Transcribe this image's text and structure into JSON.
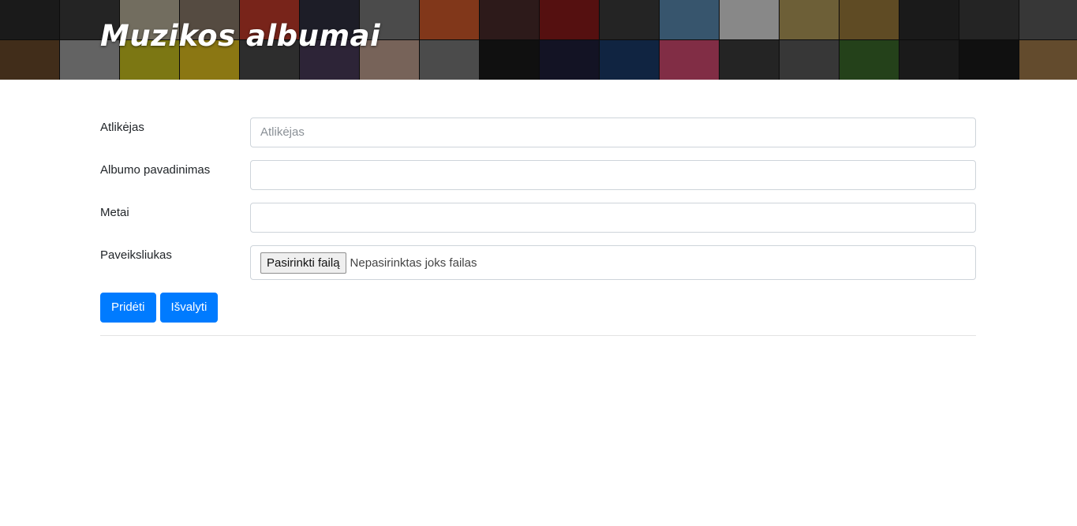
{
  "header": {
    "title": "Muzikos albumai"
  },
  "form": {
    "artist": {
      "label": "Atlikėjas",
      "placeholder": "Atlikėjas",
      "value": ""
    },
    "album": {
      "label": "Albumo pavadinimas",
      "value": ""
    },
    "year": {
      "label": "Metai",
      "value": ""
    },
    "image": {
      "label": "Paveiksliukas",
      "button_label": "Pasirinkti failą",
      "status": "Nepasirinktas joks failas"
    }
  },
  "actions": {
    "add_label": "Pridėti",
    "clear_label": "Išvalyti"
  },
  "colors": {
    "primary": "#007bff",
    "input_border": "#ced4da",
    "divider": "#e3e3e3"
  }
}
